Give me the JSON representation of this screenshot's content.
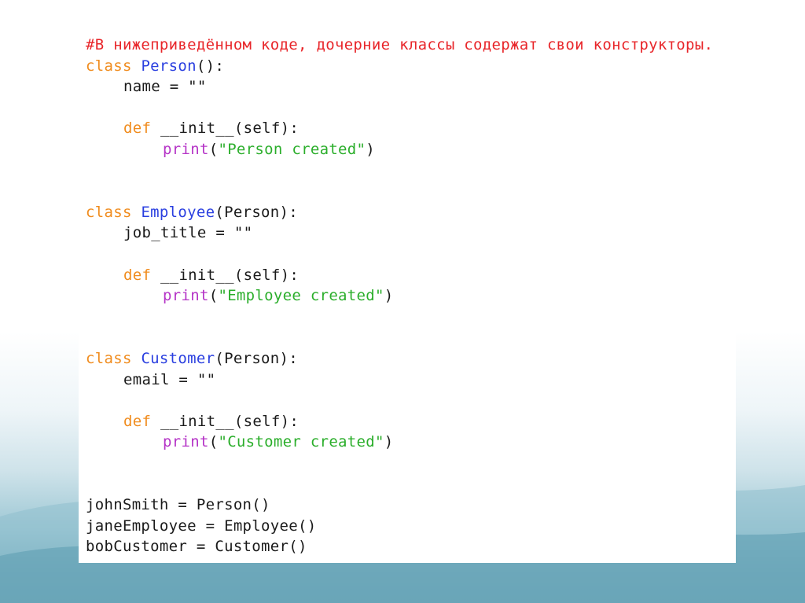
{
  "code": {
    "comment": "#В нижеприведённом коде, дочерние классы содержат свои конструкторы.",
    "person": {
      "class_kw": "class ",
      "class_name": "Person",
      "class_tail": "():",
      "attr": "name = \"\"",
      "def_kw": "def ",
      "def_name": "__init__(self):",
      "print_fn": "print",
      "print_open": "(",
      "print_str": "\"Person created\"",
      "print_close": ")"
    },
    "employee": {
      "class_kw": "class ",
      "class_name": "Employee",
      "class_tail": "(Person):",
      "attr": "job_title = \"\"",
      "def_kw": "def ",
      "def_name": "__init__(self):",
      "print_fn": "print",
      "print_open": "(",
      "print_str": "\"Employee created\"",
      "print_close": ")"
    },
    "customer": {
      "class_kw": "class ",
      "class_name": "Customer",
      "class_tail": "(Person):",
      "attr": "email = \"\"",
      "def_kw": "def ",
      "def_name": "__init__(self):",
      "print_fn": "print",
      "print_open": "(",
      "print_str": "\"Customer created\"",
      "print_close": ")"
    },
    "instances": [
      "johnSmith = Person()",
      "janeEmployee = Employee()",
      "bobCustomer = Customer()"
    ]
  },
  "colors": {
    "comment": "#e8262a",
    "keyword": "#f08c1e",
    "class_name": "#2a3fe0",
    "function": "#b534c7",
    "string": "#2bae2b"
  }
}
